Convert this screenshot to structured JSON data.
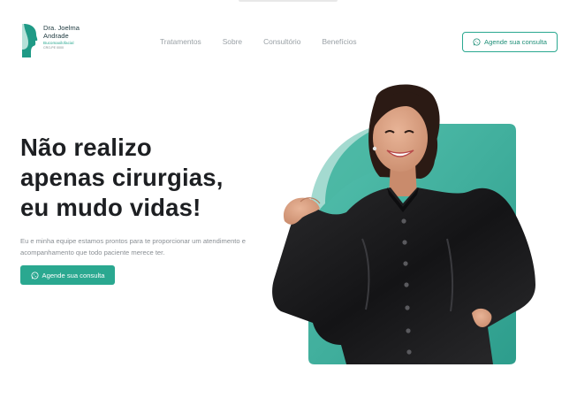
{
  "header": {
    "logo": {
      "name_line1": "Dra. Joelma",
      "name_line2": "Andrade",
      "role": "Bucomaxilofacial",
      "cro": "CRO-PE 0000"
    },
    "nav": [
      {
        "label": "Tratamentos"
      },
      {
        "label": "Sobre"
      },
      {
        "label": "Consultório"
      },
      {
        "label": "Benefícios"
      }
    ],
    "cta_label": "Agende sua consulta"
  },
  "hero": {
    "title_lines": [
      "Não realizo",
      "apenas cirurgias,",
      "eu mudo vidas!"
    ],
    "subtitle": "Eu e minha equipe estamos prontos para te proporcionar um atendimento e acompanhamento que todo paciente merece ter.",
    "cta_label": "Agende sua consulta"
  },
  "colors": {
    "brand_teal": "#2aa890",
    "card_teal": "#4fbba8",
    "dark_text": "#1d1f22"
  },
  "icons": {
    "cta_icon": "whatsapp-icon",
    "logo_icon": "face-profile-logo-icon"
  }
}
